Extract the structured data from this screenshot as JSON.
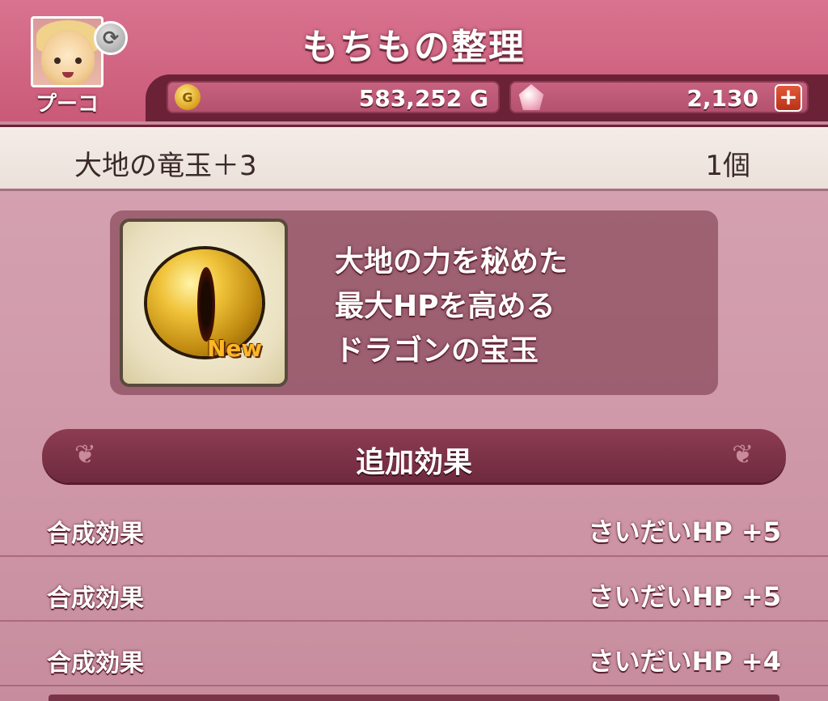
{
  "header": {
    "title": "もちもの整理",
    "player_name": "プーコ",
    "swap_icon": "swap-icon"
  },
  "currency": {
    "gold": "583,252 G",
    "gems": "2,130",
    "coin_symbol": "G",
    "plus_symbol": "+"
  },
  "item": {
    "name": "大地の竜玉＋3",
    "count": "1個",
    "new_label": "New",
    "description": [
      "大地の力を秘めた",
      "最大HPを高める",
      "ドラゴンの宝玉"
    ]
  },
  "effects": {
    "title": "追加効果",
    "rows": [
      {
        "label": "合成効果",
        "value": "さいだいHP  +5"
      },
      {
        "label": "合成効果",
        "value": "さいだいHP  +5"
      },
      {
        "label": "合成効果",
        "value": "さいだいHP  +4"
      }
    ]
  },
  "colors": {
    "header_bg": "#d9738f",
    "bar_bg": "#6b2236",
    "accent_gold": "#ffb626"
  }
}
